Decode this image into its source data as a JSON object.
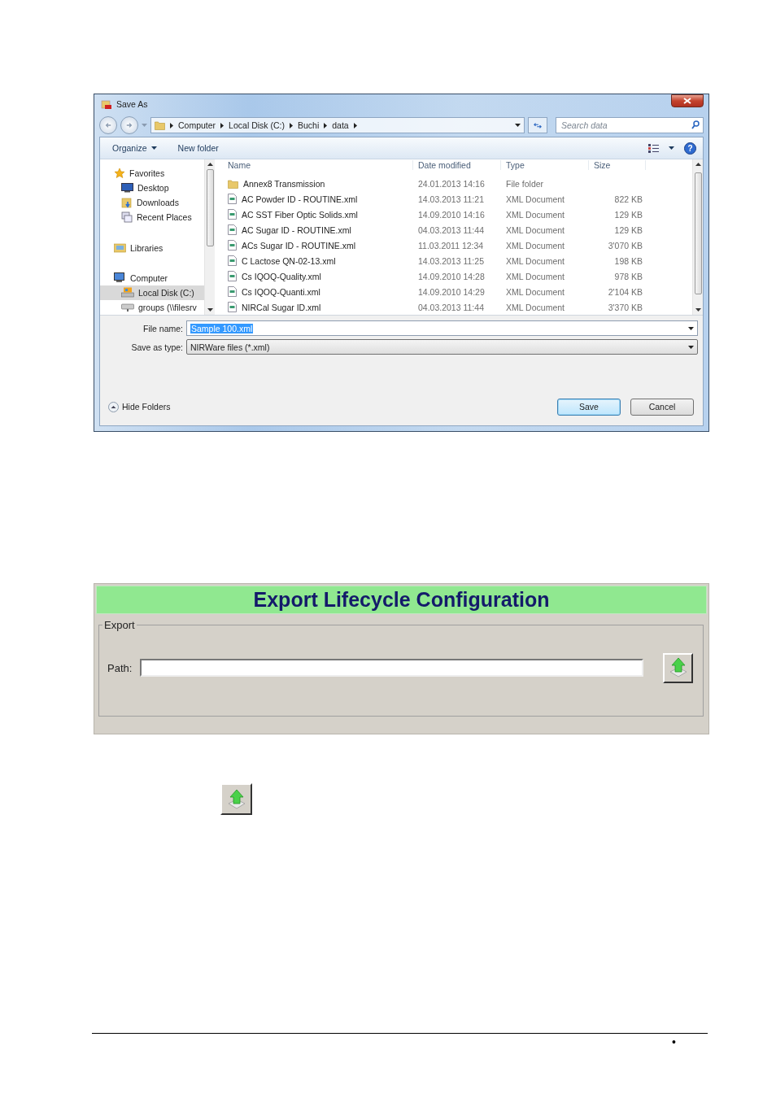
{
  "dialog": {
    "title": "Save As",
    "breadcrumb": [
      "Computer",
      "Local Disk (C:)",
      "Buchi",
      "data"
    ],
    "search": {
      "placeholder": "Search data"
    },
    "toolbar": {
      "organize": "Organize",
      "new_folder": "New folder",
      "help": "?"
    },
    "sidebar": {
      "items": [
        {
          "label": "Favorites",
          "kind": "favorites",
          "selected": false,
          "children": [
            {
              "label": "Desktop",
              "kind": "desktop",
              "selected": false
            },
            {
              "label": "Downloads",
              "kind": "downloads",
              "selected": false
            },
            {
              "label": "Recent Places",
              "kind": "recent",
              "selected": false
            }
          ]
        },
        {
          "label": "Libraries",
          "kind": "libraries",
          "selected": false
        },
        {
          "label": "Computer",
          "kind": "computer",
          "selected": false,
          "children": [
            {
              "label": "Local Disk (C:)",
              "kind": "drive",
              "selected": true
            },
            {
              "label": "groups (\\\\filesrv",
              "kind": "network",
              "selected": false
            }
          ]
        }
      ]
    },
    "columns": [
      "Name",
      "Date modified",
      "Type",
      "Size"
    ],
    "rows": [
      {
        "kind": "folder",
        "name": "Annex8 Transmission",
        "date": "24.01.2013 14:16",
        "type": "File folder"
      },
      {
        "kind": "xml",
        "name": "AC Powder ID - ROUTINE.xml",
        "date": "14.03.2013 11:21",
        "type": "XML Document",
        "size": "822 KB"
      },
      {
        "kind": "xml",
        "name": "AC SST Fiber Optic Solids.xml",
        "date": "14.09.2010 14:16",
        "type": "XML Document",
        "size": "129 KB"
      },
      {
        "kind": "xml",
        "name": "AC Sugar ID - ROUTINE.xml",
        "date": "04.03.2013 11:44",
        "type": "XML Document",
        "size": "129 KB"
      },
      {
        "kind": "xml",
        "name": "ACs Sugar ID - ROUTINE.xml",
        "date": "11.03.2011 12:34",
        "type": "XML Document",
        "size": "3'070 KB"
      },
      {
        "kind": "xml",
        "name": "C Lactose QN-02-13.xml",
        "date": "14.03.2013 11:25",
        "type": "XML Document",
        "size": "198 KB"
      },
      {
        "kind": "xml",
        "name": "Cs IQOQ-Quality.xml",
        "date": "14.09.2010 14:28",
        "type": "XML Document",
        "size": "978 KB"
      },
      {
        "kind": "xml",
        "name": "Cs IQOQ-Quanti.xml",
        "date": "14.09.2010 14:29",
        "type": "XML Document",
        "size": "2'104 KB"
      },
      {
        "kind": "xml",
        "name": "NIRCal Sugar ID.xml",
        "date": "04.03.2013 11:44",
        "type": "XML Document",
        "size": "3'370 KB"
      }
    ],
    "file_name": {
      "label": "File name:",
      "value": "Sample 100.xml",
      "highlighted": true
    },
    "save_as_type": {
      "label": "Save as type:",
      "value": "NIRWare files (*.xml)"
    },
    "hide_folders": "Hide Folders",
    "buttons": [
      {
        "label": "Save",
        "default": true
      },
      {
        "label": "Cancel",
        "default": false
      }
    ]
  },
  "export_panel": {
    "title": "Export Lifecycle Configuration",
    "group": "Export",
    "path_label": "Path:"
  },
  "footer": {
    "bullet": "•"
  }
}
